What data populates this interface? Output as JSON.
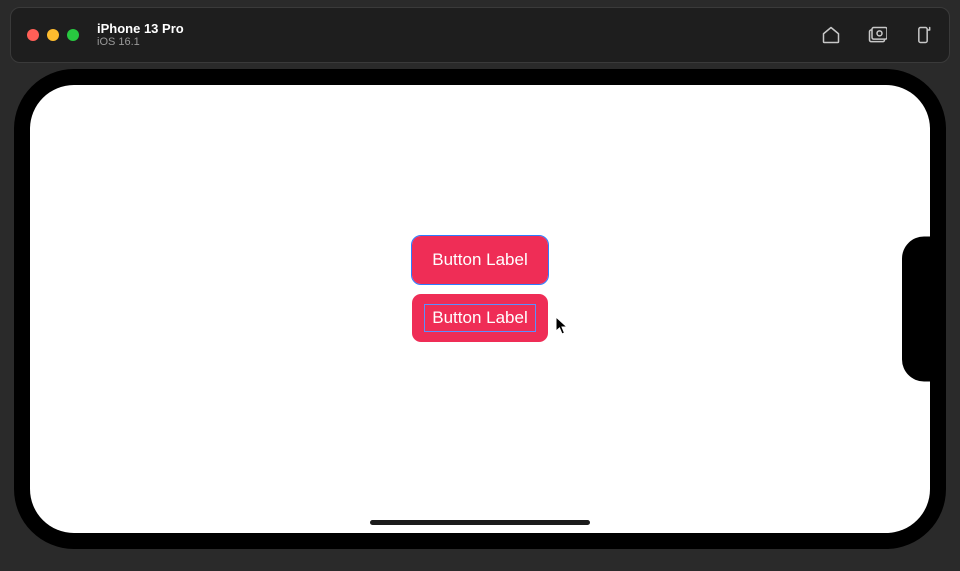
{
  "toolbar": {
    "device_name": "iPhone 13 Pro",
    "os_version": "iOS 16.1",
    "icons": {
      "home": "home-icon",
      "screenshot": "screenshot-icon",
      "rotate": "rotate-icon"
    }
  },
  "screen": {
    "buttons": [
      {
        "label": "Button Label",
        "selected": true
      },
      {
        "label": "Button Label",
        "selected": false
      }
    ]
  },
  "colors": {
    "button_bg": "#ef2d56",
    "selection_outline": "#2e7bff"
  }
}
